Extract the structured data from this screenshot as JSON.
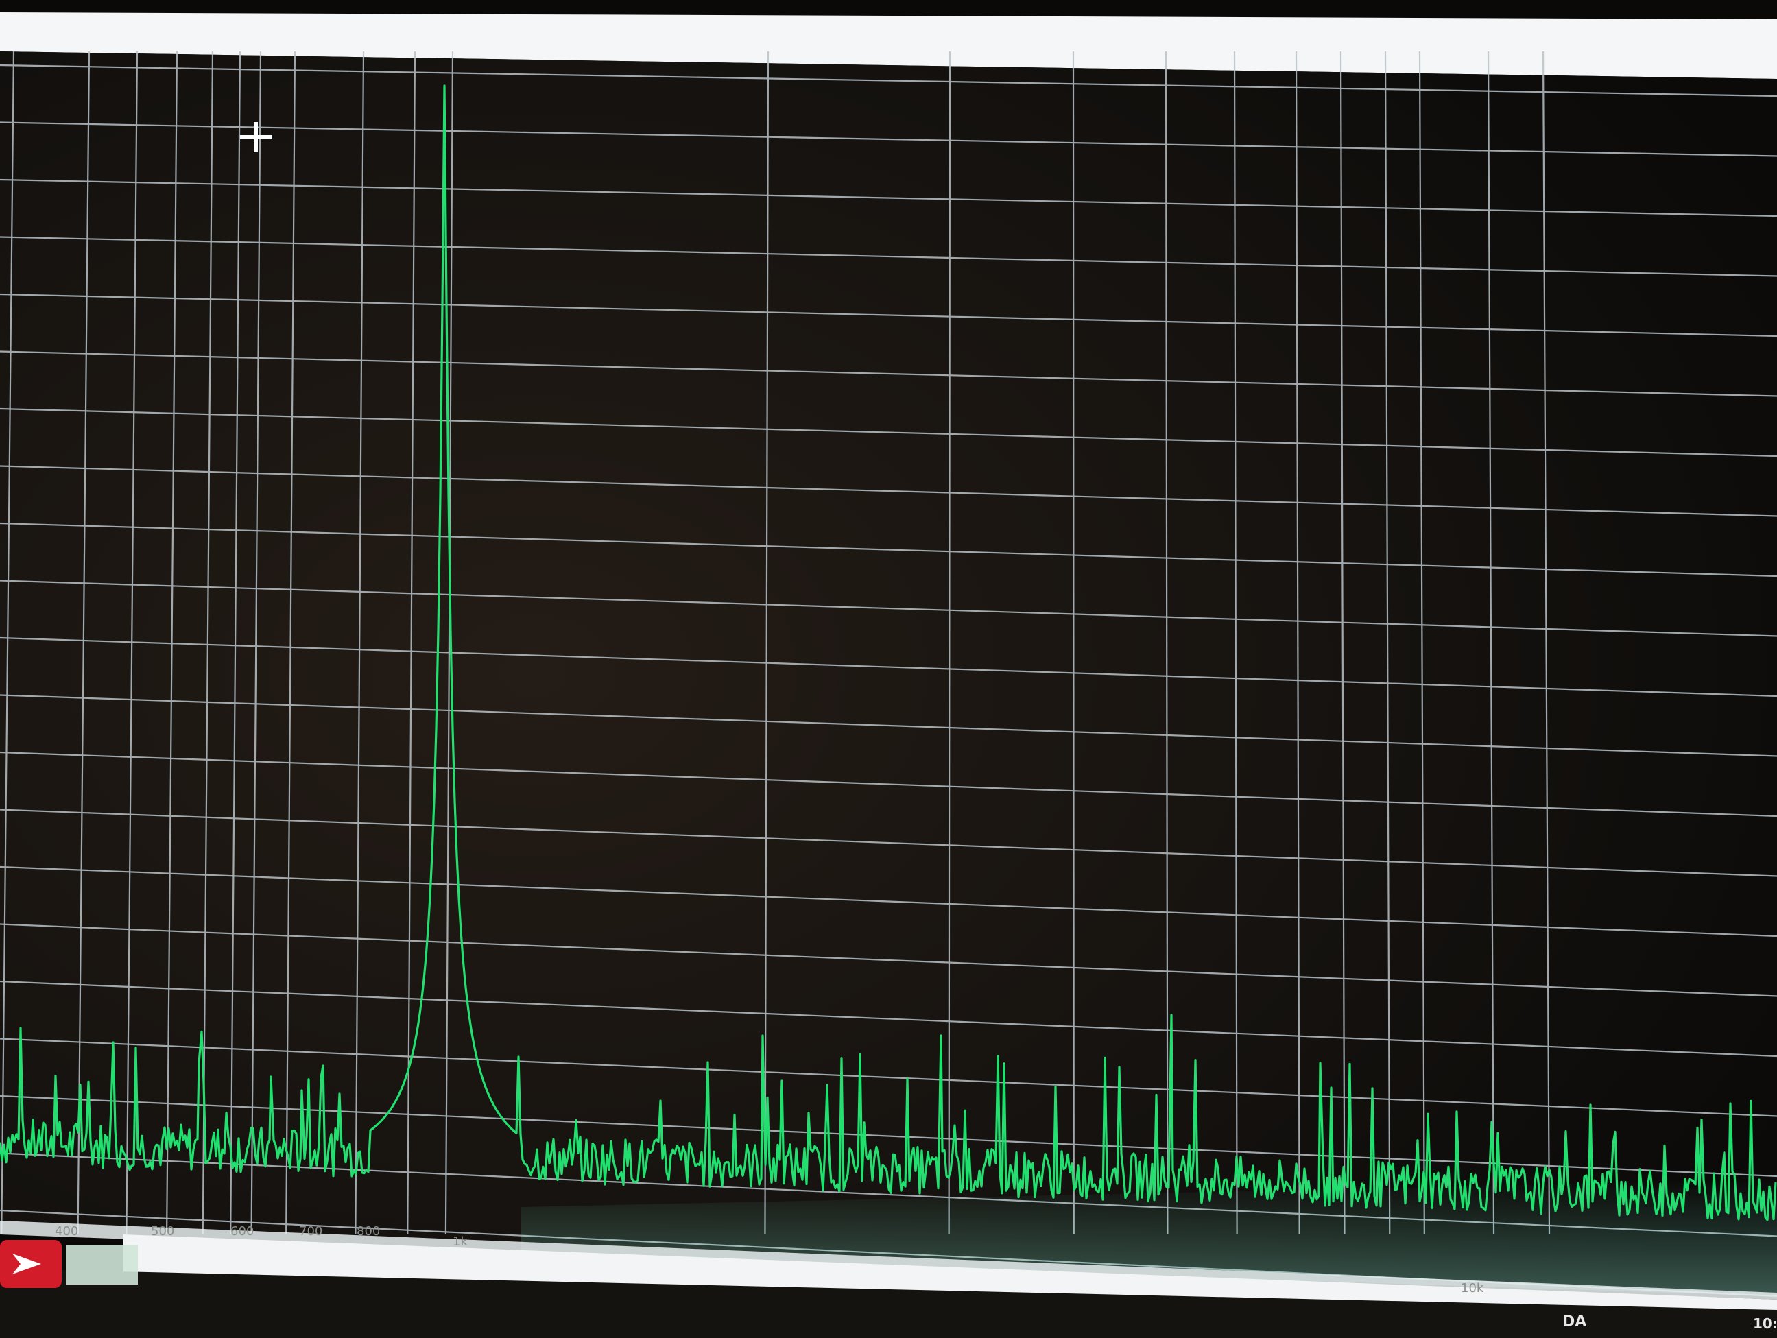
{
  "cursor": {
    "icon": "crosshair-cursor-icon"
  },
  "analyzer": {
    "trace_color": "#22e070",
    "grid_color": "#b9c3c9",
    "x_tick_labels": [
      "400",
      "500",
      "600",
      "700",
      "800",
      "1k",
      "10k"
    ]
  },
  "taskbar": {
    "app_icon": "app-arrow-icon",
    "tray_label": "DA",
    "clock_partial": "10:"
  }
}
